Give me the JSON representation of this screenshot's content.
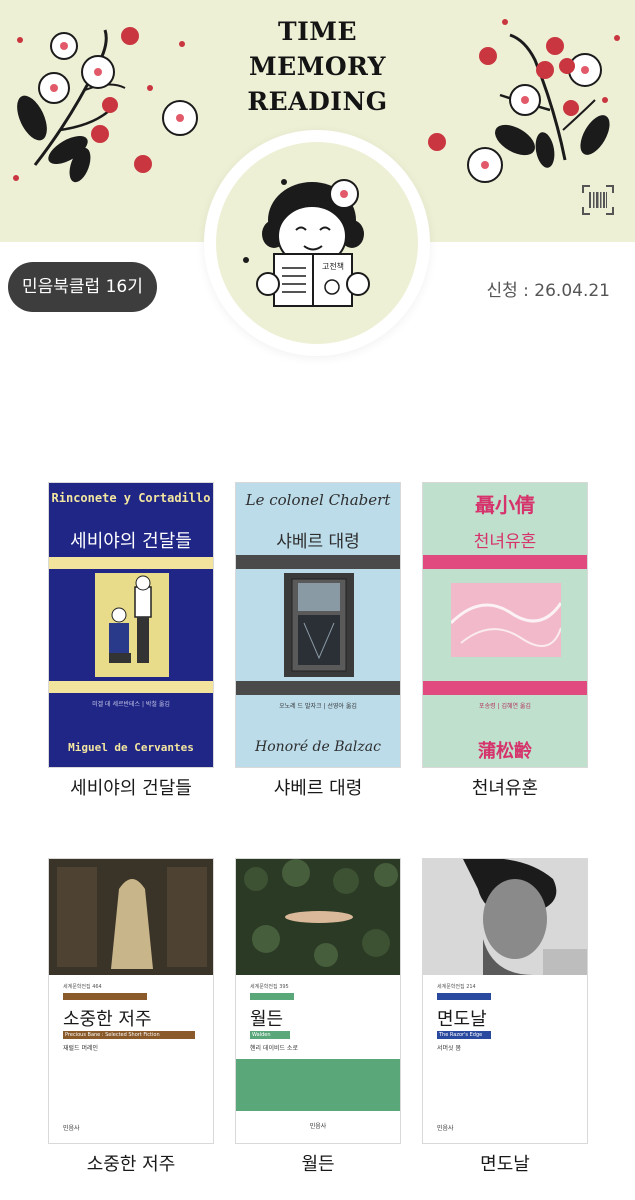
{
  "banner": {
    "title_lines": [
      "TIME",
      "MEMORY",
      "READING"
    ],
    "avatar_book_label": "고전책"
  },
  "profile": {
    "club_label": "민음북클럽 16기",
    "apply_date": "신청 : 26.04.21"
  },
  "icons": {
    "barcode": "barcode-icon"
  },
  "books": [
    {
      "title": "세비야의 건달들",
      "cover_original_title": "Rinconete y Cortadillo",
      "cover_korean_title": "세비야의 건달들",
      "cover_author": "Miguel de Cervantes",
      "cover_credit": "미겔 데 세르반테스 | 박철 옮김",
      "colors": {
        "bg": "#1f2686",
        "accent": "#f2e49c",
        "text": "#f3e6a0"
      }
    },
    {
      "title": "샤베르 대령",
      "cover_original_title": "Le colonel Chabert",
      "cover_korean_title": "샤베르 대령",
      "cover_author": "Honoré de Balzac",
      "cover_credit": "오노레 드 발자크 | 선영아 옮김",
      "colors": {
        "bg": "#bcdcea",
        "accent": "#4a4a4a",
        "text": "#2e2e2e"
      }
    },
    {
      "title": "천녀유혼",
      "cover_original_title": "聶小倩",
      "cover_korean_title": "천녀유혼",
      "cover_author": "蒲松齡",
      "cover_credit": "포송령 | 김혜연 옮김",
      "colors": {
        "bg": "#bfe0cd",
        "accent": "#e04a7e",
        "text": "#d6336c"
      }
    },
    {
      "title": "소중한 저주",
      "cover_series": "세계문학전집 464",
      "cover_korean_title": "소중한 저주",
      "cover_subtitle": "Precious Bane : Selected Short Fiction",
      "cover_author": "재럴드 머레인",
      "cover_publisher": "민음사",
      "colors": {
        "bar": "#8a5a2a",
        "photo": "#3a3328"
      }
    },
    {
      "title": "월든",
      "cover_series": "세계문학전집 395",
      "cover_korean_title": "월든",
      "cover_subtitle": "Walden",
      "cover_author": "헨리 데이비드 소로",
      "cover_publisher": "민음사",
      "colors": {
        "bar": "#5aa77a",
        "photo": "#2b3a25",
        "panel": "#5aa77a"
      }
    },
    {
      "title": "면도날",
      "cover_series": "세계문학전집 214",
      "cover_korean_title": "면도날",
      "cover_subtitle": "The Razor's Edge",
      "cover_author": "서머싯 몸",
      "cover_publisher": "민음사",
      "colors": {
        "bar": "#2a4aa0",
        "photo": "#d8d8d8"
      }
    }
  ]
}
